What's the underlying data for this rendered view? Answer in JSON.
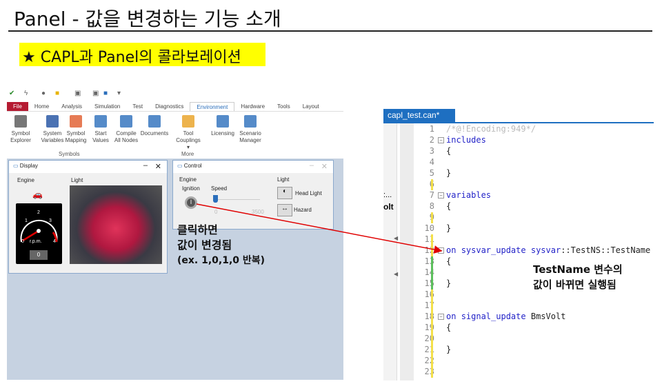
{
  "slide": {
    "title": "Panel - 값을 변경하는 기능 소개",
    "highlight": "★ CAPL과 Panel의 콜라보레이션"
  },
  "ribbon": {
    "tabs": [
      "File",
      "Home",
      "Analysis",
      "Simulation",
      "Test",
      "Diagnostics",
      "Environment",
      "Hardware",
      "Tools",
      "Layout"
    ],
    "active_tab": "Environment",
    "buttons": [
      {
        "l1": "Symbol",
        "l2": "Explorer",
        "icon": "symbol-explorer-icon"
      },
      {
        "l1": "System",
        "l2": "Variables",
        "icon": "sine-wave-icon"
      },
      {
        "l1": "Symbol",
        "l2": "Mapping",
        "icon": "mapping-icon"
      },
      {
        "l1": "Start",
        "l2": "Values",
        "icon": "start-values-icon"
      },
      {
        "l1": "Compile",
        "l2": "All Nodes",
        "icon": "compile-icon"
      },
      {
        "l1": "Documents",
        "l2": "",
        "icon": "documents-icon"
      },
      {
        "l1": "Tool",
        "l2": "Couplings ▾",
        "icon": "tool-couplings-icon"
      },
      {
        "l1": "Licensing",
        "l2": "",
        "icon": "licensing-icon"
      },
      {
        "l1": "Scenario",
        "l2": "Manager",
        "icon": "scenario-icon"
      }
    ],
    "groups": [
      "Symbols",
      "More"
    ]
  },
  "display": {
    "title": "Display",
    "engine": "Engine",
    "light": "Light",
    "gauge_ticks": [
      "0",
      "1",
      "2",
      "3",
      "4"
    ],
    "unit": "r.p.m.",
    "value": "0"
  },
  "control": {
    "title": "Control",
    "engine": "Engine",
    "ignition": "Ignition",
    "speed": "Speed",
    "speed_min": "0",
    "speed_max": "3500",
    "speed_value": 0,
    "light": "Light",
    "head_light": "Head Light",
    "hazard": "Hazard"
  },
  "annotations": {
    "left": [
      "클릭하면",
      "값이 변경됨",
      "(ex. 1,0,1,0 반복)"
    ],
    "right": [
      "TestName 변수의",
      "값이 바뀌면 실행됨"
    ]
  },
  "editor": {
    "tab": "capl_test.can*",
    "side_text": [
      ":...",
      "olt"
    ],
    "lines": [
      [
        {
          "t": "/*@!Encoding:949*/",
          "c": "cm"
        }
      ],
      [
        {
          "t": "includes",
          "c": "kw"
        }
      ],
      [
        {
          "t": "{",
          "c": ""
        }
      ],
      [],
      [
        {
          "t": "}",
          "c": ""
        }
      ],
      [],
      [
        {
          "t": "variables",
          "c": "kw"
        }
      ],
      [
        {
          "t": "{",
          "c": ""
        }
      ],
      [],
      [
        {
          "t": "}",
          "c": ""
        }
      ],
      [],
      [
        {
          "t": "on ",
          "c": "kw"
        },
        {
          "t": "sysvar_update ",
          "c": "kw"
        },
        {
          "t": "sysvar",
          "c": "kw"
        },
        {
          "t": "::TestNS::TestName",
          "c": ""
        }
      ],
      [
        {
          "t": "{",
          "c": ""
        }
      ],
      [],
      [
        {
          "t": "}",
          "c": ""
        }
      ],
      [],
      [],
      [
        {
          "t": "on ",
          "c": "kw"
        },
        {
          "t": "signal_update ",
          "c": "kw"
        },
        {
          "t": "BmsVolt",
          "c": ""
        }
      ],
      [
        {
          "t": "{",
          "c": ""
        }
      ],
      [],
      [
        {
          "t": "}",
          "c": ""
        }
      ],
      [],
      []
    ]
  },
  "colors": {
    "highlight": "#ffff00",
    "file_tab": "#b51b32",
    "editor_tab": "#1e6fc1",
    "arrow": "#e00000"
  }
}
